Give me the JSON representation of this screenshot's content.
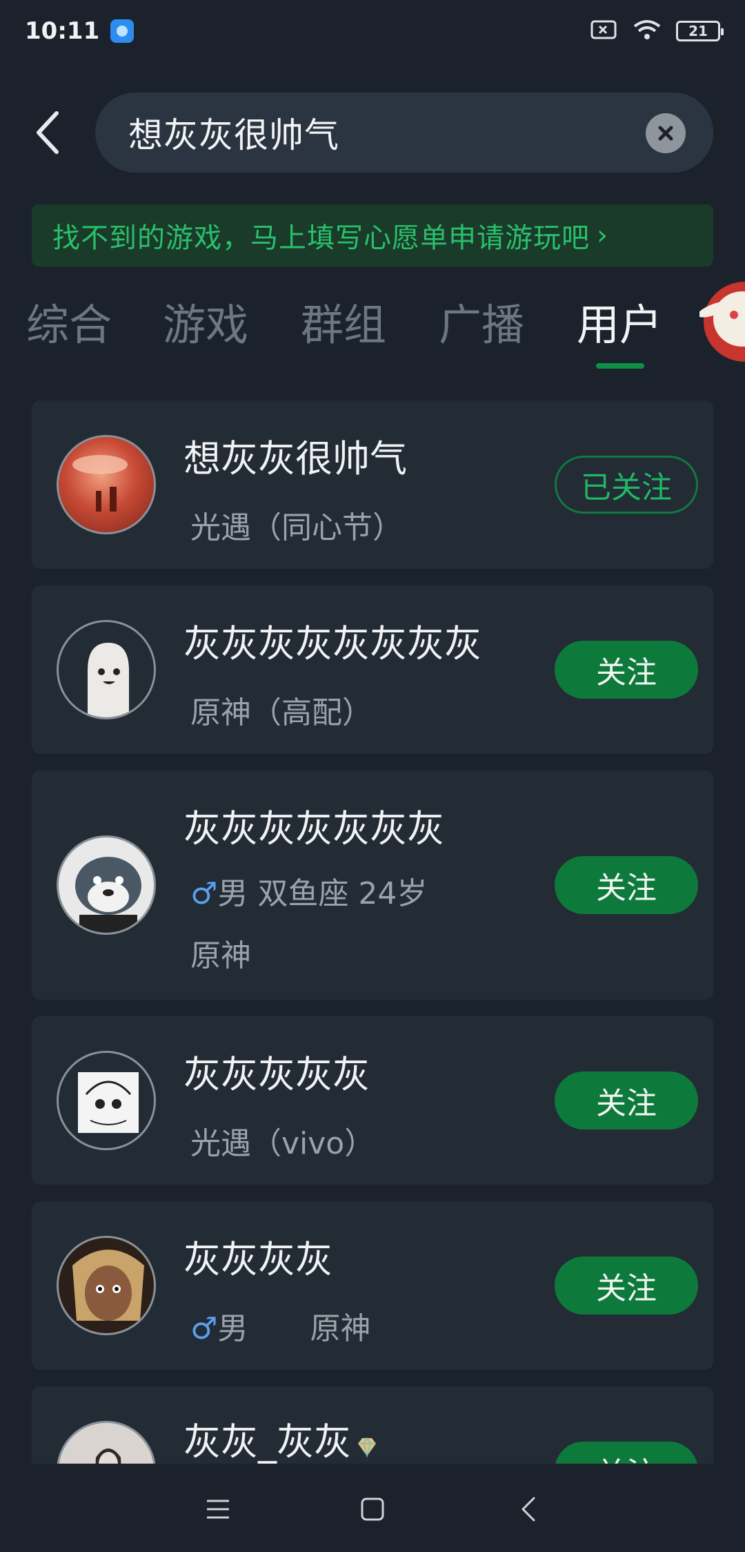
{
  "status_bar": {
    "time": "10:11",
    "battery": "21"
  },
  "search": {
    "query": "想灰灰很帅气"
  },
  "banner": {
    "text": "找不到的游戏，马上填写心愿单申请游玩吧",
    "chevron": "›"
  },
  "tabs": [
    {
      "label": "综合",
      "active": false
    },
    {
      "label": "游戏",
      "active": false
    },
    {
      "label": "群组",
      "active": false
    },
    {
      "label": "广播",
      "active": false
    },
    {
      "label": "用户",
      "active": true
    }
  ],
  "users": [
    {
      "name": "想灰灰很帅气",
      "tags": [
        "光遇（同心节）"
      ],
      "button": "已关注",
      "followed": true
    },
    {
      "name": "灰灰灰灰灰灰灰灰",
      "tags": [
        "原神（高配）"
      ],
      "button": "关注",
      "followed": false
    },
    {
      "name": "灰灰灰灰灰灰灰",
      "gender_symbol": "♂",
      "tags": [
        "男 双鱼座 24岁"
      ],
      "tags2": [
        "原神"
      ],
      "button": "关注",
      "followed": false
    },
    {
      "name": "灰灰灰灰灰",
      "tags": [
        "光遇（vivo）"
      ],
      "button": "关注",
      "followed": false
    },
    {
      "name": "灰灰灰灰",
      "gender_symbol": "♂",
      "tags": [
        "男",
        "原神"
      ],
      "button": "关注",
      "followed": false
    },
    {
      "name": "灰灰_灰灰",
      "button": "关注",
      "followed": false
    }
  ],
  "colors": {
    "accent": "#0d7a3c",
    "accent_text": "#29c06b",
    "background": "#1b222b",
    "card": "#232b35"
  }
}
